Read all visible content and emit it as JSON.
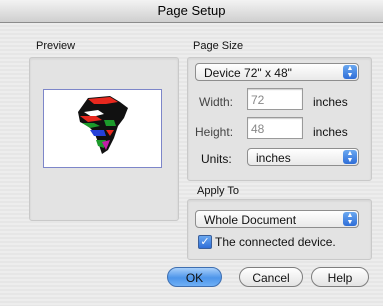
{
  "window": {
    "title": "Page Setup"
  },
  "preview": {
    "label": "Preview"
  },
  "page_size": {
    "label": "Page Size",
    "device_popup": "Device 72\" x 48\"",
    "width_label": "Width:",
    "width_value": "72",
    "width_unit": "inches",
    "height_label": "Height:",
    "height_value": "48",
    "height_unit": "inches",
    "units_label": "Units:",
    "units_value": "inches"
  },
  "apply_to": {
    "label": "Apply To",
    "popup_value": "Whole Document",
    "checkbox_label": "The connected device.",
    "checkbox_checked": true
  },
  "buttons": {
    "ok": "OK",
    "cancel": "Cancel",
    "help": "Help"
  },
  "icons": {
    "popup": "updown-arrows-icon",
    "check": "checkmark-icon",
    "preview": "africa-map-icon"
  }
}
